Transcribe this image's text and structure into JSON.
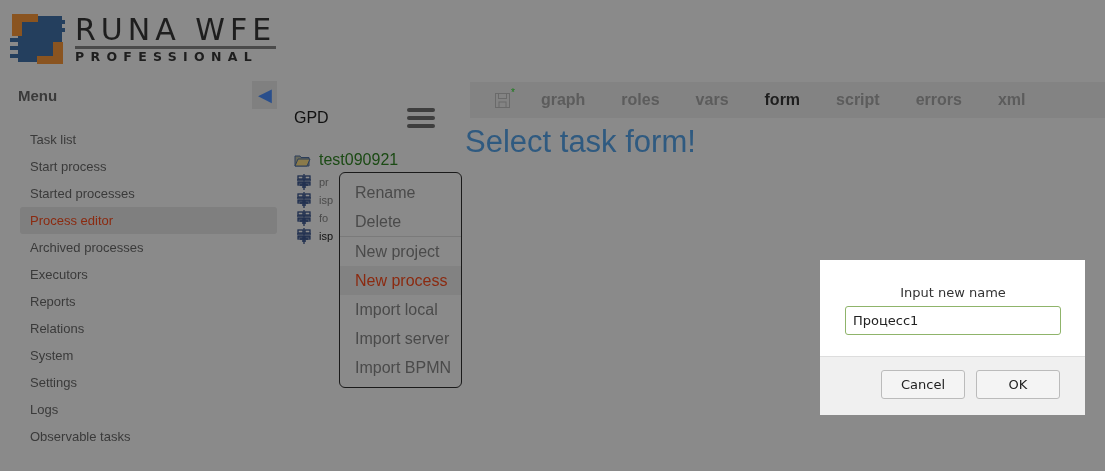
{
  "logo": {
    "title": "RUNA WFE",
    "subtitle": "PROFESSIONAL"
  },
  "sidebar": {
    "title": "Menu",
    "collapse_icon": "◀",
    "items": [
      {
        "label": "Task list",
        "selected": false
      },
      {
        "label": "Start process",
        "selected": false
      },
      {
        "label": "Started processes",
        "selected": false
      },
      {
        "label": "Process editor",
        "selected": true
      },
      {
        "label": "Archived processes",
        "selected": false
      },
      {
        "label": "Executors",
        "selected": false
      },
      {
        "label": "Reports",
        "selected": false
      },
      {
        "label": "Relations",
        "selected": false
      },
      {
        "label": "System",
        "selected": false
      },
      {
        "label": "Settings",
        "selected": false
      },
      {
        "label": "Logs",
        "selected": false
      },
      {
        "label": "Observable tasks",
        "selected": false
      }
    ]
  },
  "project_panel": {
    "title": "GPD",
    "tree": [
      {
        "label": "test090921",
        "expanded": true,
        "children": [
          {
            "label": "pr",
            "selected": false
          },
          {
            "label": "isp",
            "selected": false
          },
          {
            "label": "fo",
            "selected": false
          },
          {
            "label": "isp",
            "selected": true
          }
        ]
      }
    ]
  },
  "editor": {
    "unsaved_mark": "*",
    "tabs": [
      {
        "label": "graph",
        "selected": false
      },
      {
        "label": "roles",
        "selected": false
      },
      {
        "label": "vars",
        "selected": false
      },
      {
        "label": "form",
        "selected": true
      },
      {
        "label": "script",
        "selected": false
      },
      {
        "label": "errors",
        "selected": false
      },
      {
        "label": "xml",
        "selected": false
      }
    ],
    "message": "Select task form!"
  },
  "context_menu": {
    "groups": [
      {
        "items": [
          {
            "label": "Rename",
            "selected": false
          },
          {
            "label": "Delete",
            "selected": false
          }
        ]
      },
      {
        "items": [
          {
            "label": "New project",
            "selected": false
          },
          {
            "label": "New process",
            "selected": true
          },
          {
            "label": "Import local",
            "selected": false
          },
          {
            "label": "Import server",
            "selected": false
          },
          {
            "label": "Import BPMN",
            "selected": false
          }
        ]
      }
    ]
  },
  "dialog": {
    "label": "Input new name",
    "value": "Процесс1",
    "buttons": [
      "Cancel",
      "OK"
    ]
  }
}
